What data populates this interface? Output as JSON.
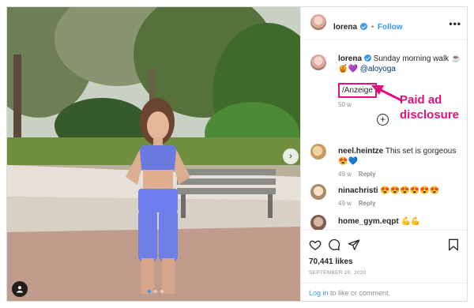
{
  "post": {
    "author": "lorena",
    "header_dot": "•",
    "follow_label": "Follow",
    "more_label": "•••",
    "caption_text": "Sunday morning walk ☕",
    "caption_emoji": "🍯💜",
    "caption_mention": "@aloyoga",
    "disclosure_tag": "/Anzeige",
    "caption_age": "50 w",
    "likes": "70,441 likes",
    "date": "SEPTEMBER 20, 2020",
    "login_link": "Log in",
    "login_rest": " to like or comment."
  },
  "comments": [
    {
      "user": "neel.heintze",
      "text": "This set is gorgeous",
      "emoji": "😍💙",
      "age": "49 w",
      "reply_label": "Reply"
    },
    {
      "user": "ninachristi",
      "text": "😍😍😍😍😍😍",
      "age": "49 w",
      "reply_label": "Reply"
    },
    {
      "user": "home_gym.eqpt",
      "text": "💪💪"
    }
  ],
  "annotation": {
    "line1": "Paid ad",
    "line2": "disclosure"
  },
  "colors": {
    "annotation": "#e0117f",
    "link_blue": "#3897f0",
    "carousel_dot_active": "#3897f0"
  },
  "icons": [
    "heart-icon",
    "comment-icon",
    "share-icon",
    "bookmark-icon",
    "user-tag-icon",
    "chevron-right-icon",
    "add-comment-icon",
    "verified-badge-icon"
  ]
}
